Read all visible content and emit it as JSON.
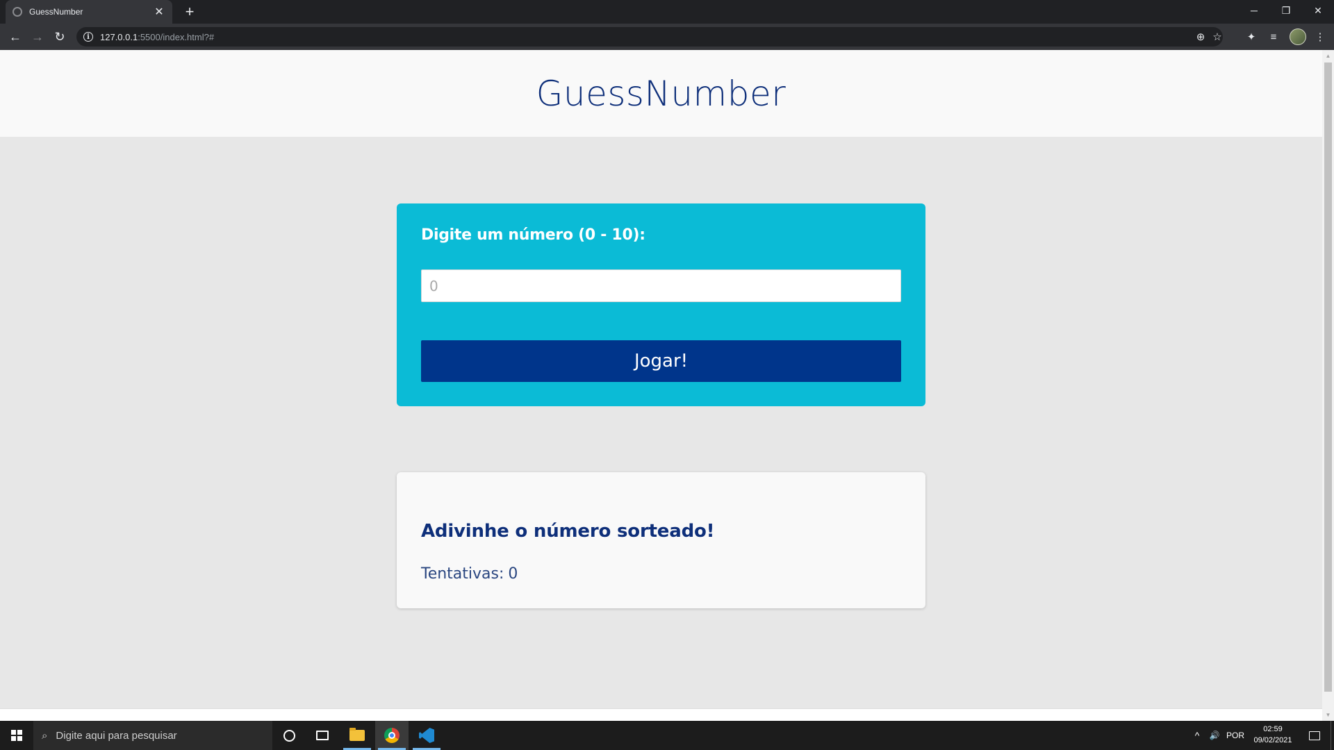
{
  "browser": {
    "tab": {
      "title": "GuessNumber",
      "close": "✕"
    },
    "new_tab": "+",
    "window_controls": {
      "minimize": "─",
      "restore": "❐",
      "close": "✕"
    },
    "nav": {
      "back": "←",
      "forward": "→",
      "reload": "↻"
    },
    "url": {
      "host": "127.0.0.1",
      "path": ":5500/index.html?#",
      "info": "i"
    },
    "omnibox_icons": {
      "zoom": "⊕",
      "bookmark": "☆"
    },
    "toolbar_icons": {
      "extensions": "✦",
      "media": "≡",
      "menu": "⋮"
    }
  },
  "page": {
    "site_title": "GuessNumber",
    "guess_form": {
      "label": "Digite um número (0 - 10):",
      "input_placeholder": "0",
      "input_value": "",
      "button_label": "Jogar!"
    },
    "result": {
      "heading": "Adivinhe o número sorteado!",
      "attempts_label": "Tentativas:",
      "attempts_value": "0"
    },
    "colors": {
      "header_bg": "#f9f9f9",
      "page_bg": "#e7e7e7",
      "card_bg": "#0bbbd6",
      "button_bg": "#00358b",
      "title_color": "#0e2f7a"
    }
  },
  "scrollbar": {
    "up": "▲",
    "down": "▼"
  },
  "taskbar": {
    "search_placeholder": "Digite aqui para pesquisar",
    "search_glass": "⌕",
    "tray": {
      "chevron": "^",
      "volume": "🔊",
      "language": "POR"
    },
    "clock": {
      "time": "02:59",
      "date": "09/02/2021"
    },
    "apps": [
      "cortana",
      "task-view",
      "file-explorer",
      "chrome",
      "vscode"
    ]
  }
}
